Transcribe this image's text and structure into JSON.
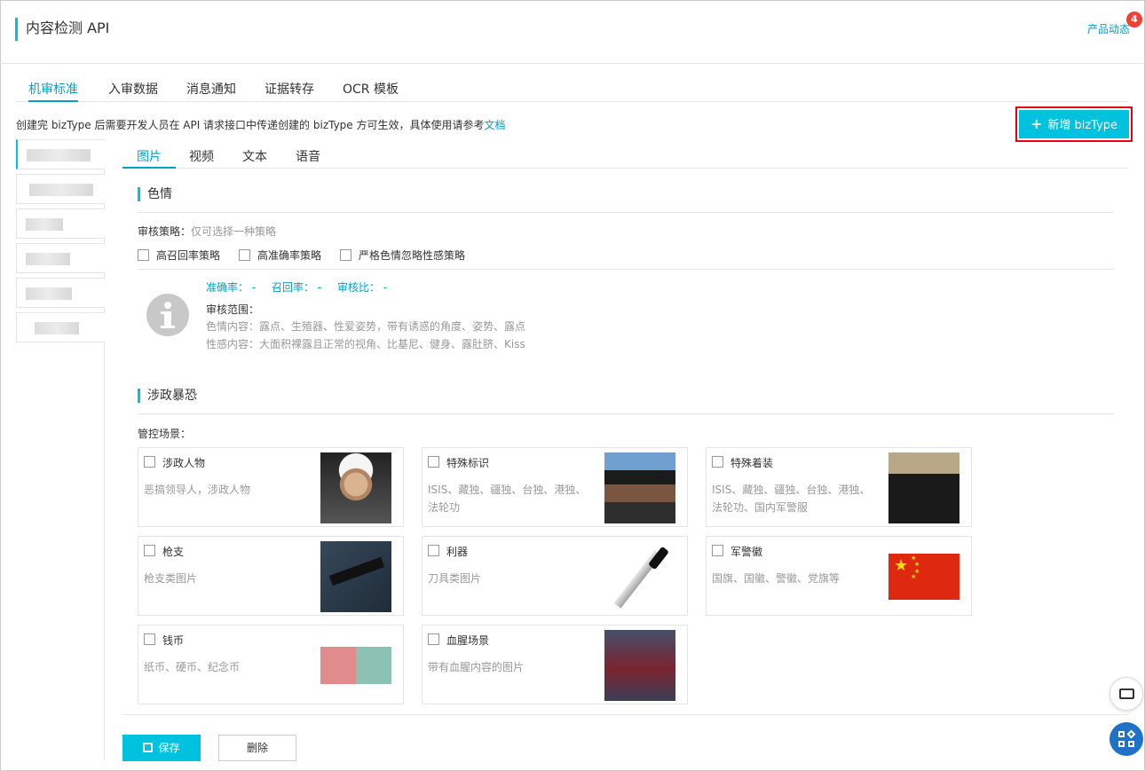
{
  "header": {
    "title": "内容检测 API",
    "product_news": "产品动态",
    "badge_count": "4"
  },
  "top_tabs": [
    "机审标准",
    "入审数据",
    "消息通知",
    "证据转存",
    "OCR 模板"
  ],
  "notice": {
    "text": "创建完 bizType 后需要开发人员在 API 请求接口中传递创建的 bizType 方可生效，具体使用请参考",
    "link": "文档"
  },
  "add_button": {
    "icon": "plus-icon",
    "label": "新增 bizType"
  },
  "media_tabs": [
    "图片",
    "视频",
    "文本",
    "语音"
  ],
  "porn": {
    "title": "色情",
    "policy_label": "审核策略：",
    "policy_hint": "仅可选择一种策略",
    "options": [
      "高召回率策略",
      "高准确率策略",
      "严格色情忽略性感策略"
    ],
    "metrics": [
      "准确率： -",
      "召回率： -",
      "审核比： -"
    ],
    "scope_label": "审核范围：",
    "scope_lines": [
      "色情内容：露点、生殖器、性爱姿势，带有诱惑的角度、姿势、露点",
      "性感内容：大面积裸露且正常的视角、比基尼、健身、露肚脐、Kiss"
    ]
  },
  "terror": {
    "title": "涉政暴恐",
    "scene_label": "管控场景：",
    "cards": [
      {
        "name": "涉政人物",
        "desc": "恶搞领导人，涉政人物",
        "icon": "political-figure-image"
      },
      {
        "name": "特殊标识",
        "desc": "ISIS、藏独、疆独、台独、港独、法轮功",
        "icon": "special-flag-image"
      },
      {
        "name": "特殊着装",
        "desc": "ISIS、藏独、疆独、台独、港独、法轮功、国内军警服",
        "icon": "special-uniform-image"
      },
      {
        "name": "枪支",
        "desc": "枪支类图片",
        "icon": "gun-image"
      },
      {
        "name": "利器",
        "desc": "刀具类图片",
        "icon": "knife-image"
      },
      {
        "name": "军警徽",
        "desc": "国旗、国徽、警徽、党旗等",
        "icon": "flag-image"
      },
      {
        "name": "钱币",
        "desc": "纸币、硬币、纪念币",
        "icon": "money-image"
      },
      {
        "name": "血腥场景",
        "desc": "带有血腥内容的图片",
        "icon": "blood-image"
      }
    ]
  },
  "footer": {
    "save_label": "保存",
    "delete_label": "删除"
  },
  "colors": {
    "accent": "#00c1de",
    "link": "#00a2ca",
    "highlight_border": "#e60012",
    "badge": "#f04134"
  }
}
